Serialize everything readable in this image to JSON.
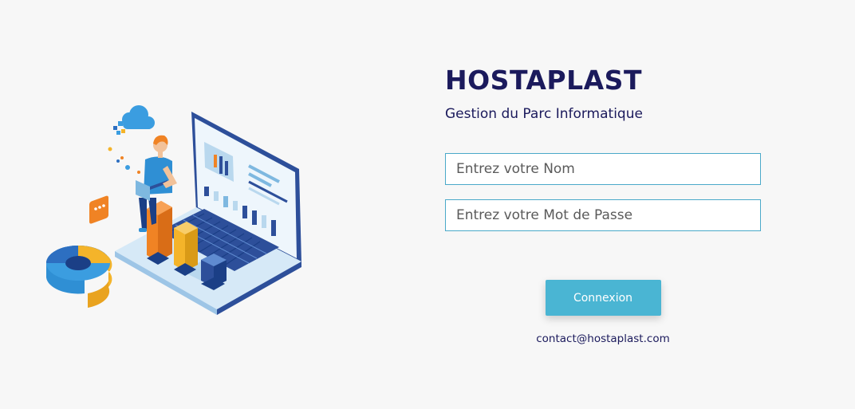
{
  "login": {
    "brand": "HOSTAPLAST",
    "subtitle": "Gestion du Parc Informatique",
    "name_placeholder": "Entrez votre Nom",
    "password_placeholder": "Entrez votre Mot de Passe",
    "submit_label": "Connexion",
    "contact_email": "contact@hostaplast.com"
  },
  "illustration": {
    "icons": [
      "laptop-icon",
      "person-icon",
      "cloud-icon",
      "chat-bubble-icon",
      "donut-chart-icon",
      "bar-chart-icon"
    ],
    "colors": {
      "navy": "#2d4f9a",
      "blue": "#2f8fd4",
      "light_blue": "#cfe6f6",
      "orange": "#f08324",
      "yellow": "#f4b42a"
    }
  },
  "colors": {
    "background": "#f7f7f7",
    "brand_text": "#1b1a5c",
    "field_border": "#4aa9c9",
    "button": "#4ab5d3"
  }
}
